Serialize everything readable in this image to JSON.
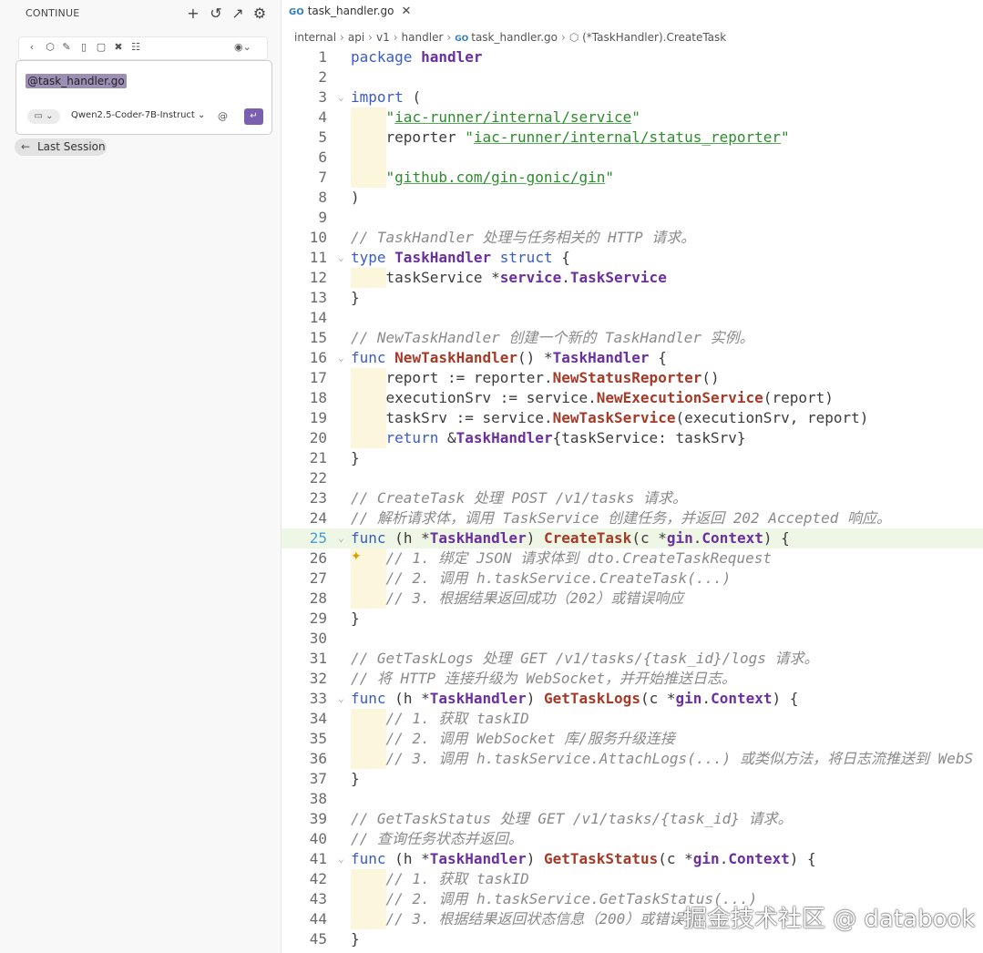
{
  "sidebar": {
    "title": "CONTINUE",
    "header_icons": [
      "plus-icon",
      "history-icon",
      "open-external-icon",
      "gear-icon"
    ],
    "toolbar_icons": [
      "back-icon",
      "cube-icon",
      "pencil-icon",
      "book-icon",
      "chat-icon",
      "tools-icon",
      "grid-icon",
      "settings-dropdown-icon"
    ],
    "input": {
      "mention": "@task_handler.go",
      "mode_icon": "chat-bubble-icon",
      "model": "Qwen2.5-Coder-7B-Instruct",
      "at_label": "@"
    },
    "last_session": "Last Session"
  },
  "editor": {
    "tab": {
      "label": "task_handler.go",
      "icon": "go-file-icon",
      "lang_badge": "GO"
    },
    "breadcrumb": [
      "internal",
      "api",
      "v1",
      "handler",
      "task_handler.go",
      "(*TaskHandler).CreateTask"
    ],
    "current_line": 25,
    "lines": [
      "package handler",
      "",
      "import (",
      "    \"iac-runner/internal/service\"",
      "    reporter \"iac-runner/internal/status_reporter\"",
      "",
      "    \"github.com/gin-gonic/gin\"",
      ")",
      "",
      "// TaskHandler 处理与任务相关的 HTTP 请求。",
      "type TaskHandler struct {",
      "    taskService *service.TaskService",
      "}",
      "",
      "// NewTaskHandler 创建一个新的 TaskHandler 实例。",
      "func NewTaskHandler() *TaskHandler {",
      "    report := reporter.NewStatusReporter()",
      "    executionSrv := service.NewExecutionService(report)",
      "    taskSrv := service.NewTaskService(executionSrv, report)",
      "    return &TaskHandler{taskService: taskSrv}",
      "}",
      "",
      "// CreateTask 处理 POST /v1/tasks 请求。",
      "// 解析请求体，调用 TaskService 创建任务，并返回 202 Accepted 响应。",
      "func (h *TaskHandler) CreateTask(c *gin.Context) {",
      "    // 1. 绑定 JSON 请求体到 dto.CreateTaskRequest",
      "    // 2. 调用 h.taskService.CreateTask(...)",
      "    // 3. 根据结果返回成功（202）或错误响应",
      "}",
      "",
      "// GetTaskLogs 处理 GET /v1/tasks/{task_id}/logs 请求。",
      "// 将 HTTP 连接升级为 WebSocket，并开始推送日志。",
      "func (h *TaskHandler) GetTaskLogs(c *gin.Context) {",
      "    // 1. 获取 taskID",
      "    // 2. 调用 WebSocket 库/服务升级连接",
      "    // 3. 调用 h.taskService.AttachLogs(...) 或类似方法，将日志流推送到 WebS",
      "}",
      "",
      "// GetTaskStatus 处理 GET /v1/tasks/{task_id} 请求。",
      "// 查询任务状态并返回。",
      "func (h *TaskHandler) GetTaskStatus(c *gin.Context) {",
      "    // 1. 获取 taskID",
      "    // 2. 调用 h.taskService.GetTaskStatus(...)",
      "    // 3. 根据结果返回状态信息（200）或错误",
      "}"
    ]
  },
  "watermark": "掘金技术社区 @ databook"
}
